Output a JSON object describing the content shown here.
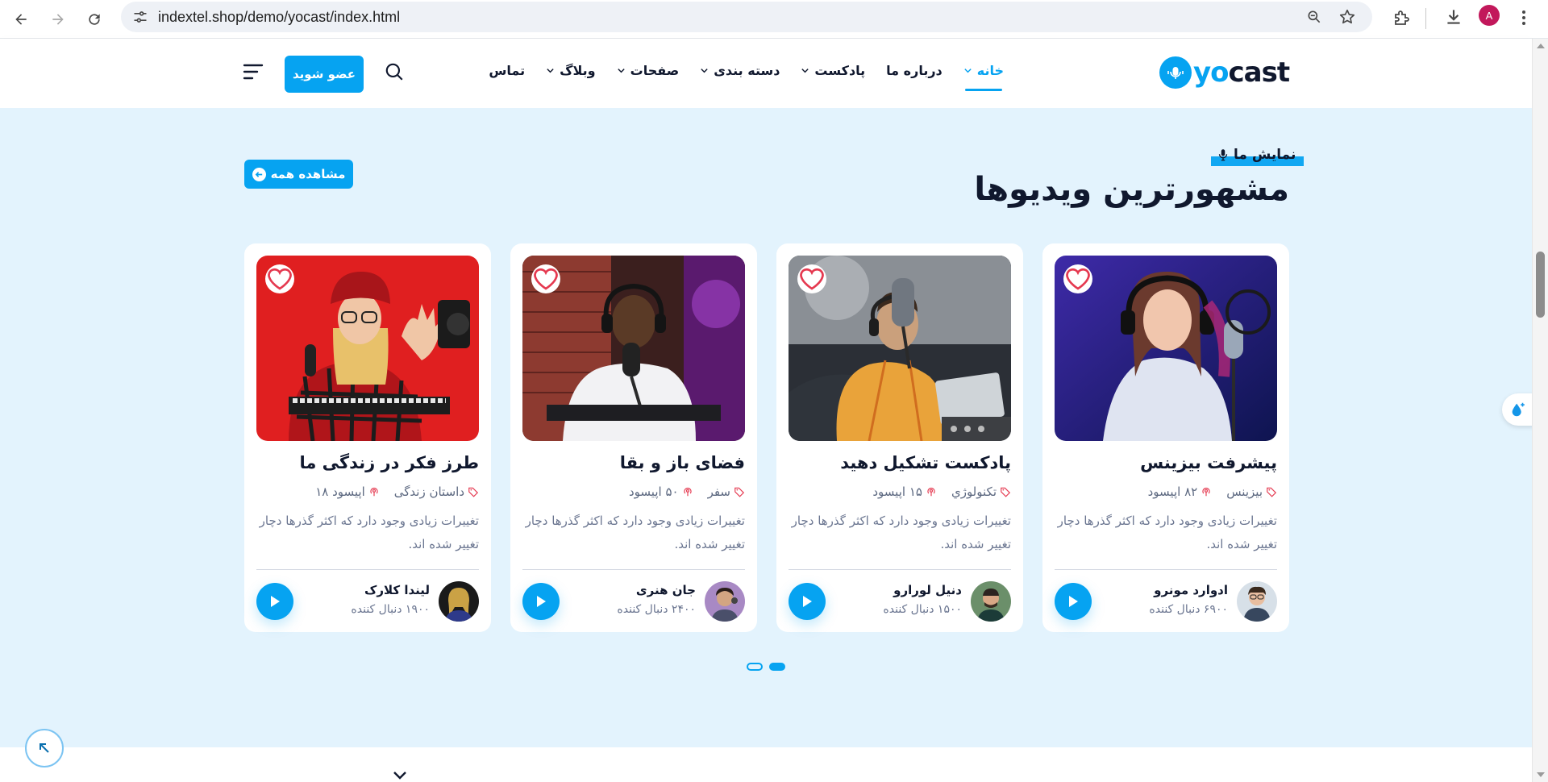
{
  "browser": {
    "url": "indextel.shop/demo/yocast/index.html",
    "profile_initial": "A",
    "profile_color": "#c2185b"
  },
  "header": {
    "logo_part1": "yo",
    "logo_part2": "cast",
    "nav": [
      {
        "label": "خانه",
        "has_dropdown": true,
        "active": true
      },
      {
        "label": "درباره ما",
        "has_dropdown": false,
        "active": false
      },
      {
        "label": "پادکست",
        "has_dropdown": true,
        "active": false
      },
      {
        "label": "دسته بندی",
        "has_dropdown": true,
        "active": false
      },
      {
        "label": "صفحات",
        "has_dropdown": true,
        "active": false
      },
      {
        "label": "وبلاگ",
        "has_dropdown": true,
        "active": false
      },
      {
        "label": "تماس",
        "has_dropdown": false,
        "active": false
      }
    ],
    "join_label": "عضو شوید"
  },
  "section": {
    "eyebrow": "نمایش ما",
    "title": "مشهورترین ویدیوها",
    "view_all": "مشاهده همه",
    "cards": [
      {
        "title": "پیشرفت بیزینس",
        "category": "بیزینس",
        "episodes": "۸۲ اپیسود",
        "description": "تغییرات زیادی وجود دارد که اکثر گذرها دچار تغییر شده اند.",
        "author": "ادوارد مونرو",
        "followers": "۶۹۰۰ دنبال کننده"
      },
      {
        "title": "پادکست تشکیل دهید",
        "category": "تکنولوژي",
        "episodes": "۱۵ اپیسود",
        "description": "تغییرات زیادی وجود دارد که اکثر گذرها دچار تغییر شده اند.",
        "author": "دنیل لورارو",
        "followers": "۱۵۰۰ دنبال کننده"
      },
      {
        "title": "فضای باز و بقا",
        "category": "سفر",
        "episodes": "۵۰ اپیسود",
        "description": "تغییرات زیادی وجود دارد که اکثر گذرها دچار تغییر شده اند.",
        "author": "جان هنری",
        "followers": "۲۴۰۰ دنبال کننده"
      },
      {
        "title": "طرز فکر در زندگی ما",
        "category": "داستان زندگی",
        "episodes": "اپیسود ۱۸",
        "description": "تغییرات زیادی وجود دارد که اکثر گذرها دچار تغییر شده اند.",
        "author": "لیندا کلارک",
        "followers": "۱۹۰۰ دنبال کننده"
      }
    ],
    "pagination": {
      "pages": 2,
      "active": 2
    }
  },
  "colors": {
    "accent": "#06a3f1",
    "heading": "#10182e",
    "section_bg": "#e3f3fd"
  }
}
